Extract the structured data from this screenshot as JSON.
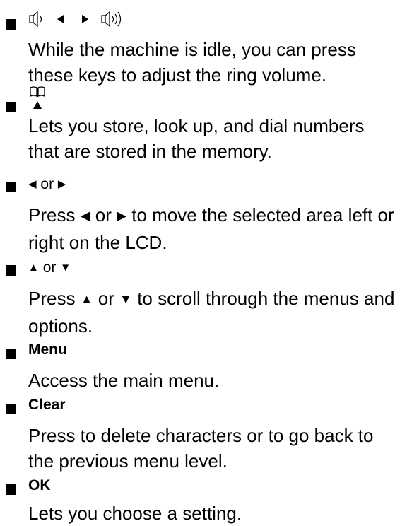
{
  "items": [
    {
      "key_icons": [
        "speaker-low-icon",
        "left-arrow-icon",
        "right-arrow-icon",
        "speaker-high-icon"
      ],
      "description": "While the machine is idle, you can press these keys to adjust the ring volume."
    },
    {
      "key_icons": [
        "book-icon",
        "up-arrow-icon"
      ],
      "description": "Lets you store, look up, and dial numbers that are stored in the memory."
    },
    {
      "key_left": "◀",
      "key_or": "or",
      "key_right": "▶",
      "desc_press": "Press",
      "desc_left": "◀",
      "desc_or": "or",
      "desc_right": "▶",
      "desc_rest": "to move the selected area left or right on the LCD."
    },
    {
      "key_up": "▲",
      "key_or": "or",
      "key_down": "▼",
      "desc_press": "Press",
      "desc_up": "▲",
      "desc_or": "or",
      "desc_down": "▼",
      "desc_rest": "to scroll through the menus and options."
    },
    {
      "key": "Menu",
      "description": "Access the main menu."
    },
    {
      "key": "Clear",
      "description": "Press to delete characters or to go back to the previous menu level."
    },
    {
      "key": "OK",
      "description": "Lets you choose a setting."
    }
  ]
}
